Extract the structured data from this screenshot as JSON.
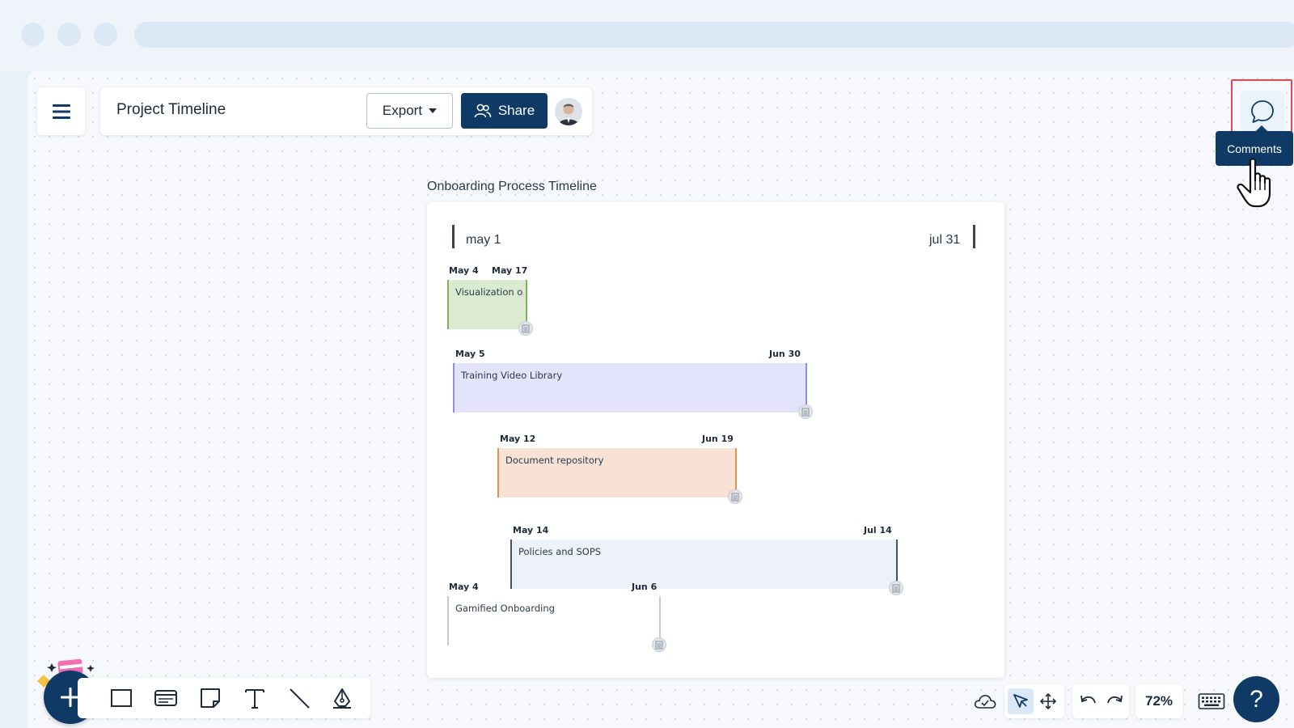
{
  "header": {
    "title": "Project Timeline",
    "export_label": "Export",
    "share_label": "Share"
  },
  "comments": {
    "tooltip": "Comments"
  },
  "timeline": {
    "heading": "Onboarding Process Timeline",
    "range_start": "may 1",
    "range_end": "jul 31",
    "bars": [
      {
        "label": "Visualization o",
        "start": "May 4",
        "end": "May 17",
        "fill": "#dbebd2",
        "edge": "#7db55a"
      },
      {
        "label": "Training Video Library",
        "start": "May 5",
        "end": "Jun 30",
        "fill": "#e3e3fb",
        "edge": "#8b8fe8"
      },
      {
        "label": "Document repository",
        "start": "May 12",
        "end": "Jun 19",
        "fill": "#f7e2d5",
        "edge": "#e0914f"
      },
      {
        "label": "Policies and SOPS",
        "start": "May 14",
        "end": "Jul 14",
        "fill": "#edf1fa",
        "edge": "#4a535e"
      },
      {
        "label": "Gamified Onboarding",
        "start": "May 4",
        "end": "Jun 6",
        "fill": "#ffffff",
        "edge": "#c8ccd2"
      }
    ]
  },
  "toolbar": {
    "tools": [
      "rectangle-tool",
      "card-tool",
      "sticky-note-tool",
      "text-tool",
      "line-tool",
      "pen-tool"
    ]
  },
  "zoom": {
    "level": "72%"
  },
  "help": {
    "label": "?"
  },
  "colors": {
    "primary": "#0f3a66",
    "highlight": "#e0475b"
  }
}
